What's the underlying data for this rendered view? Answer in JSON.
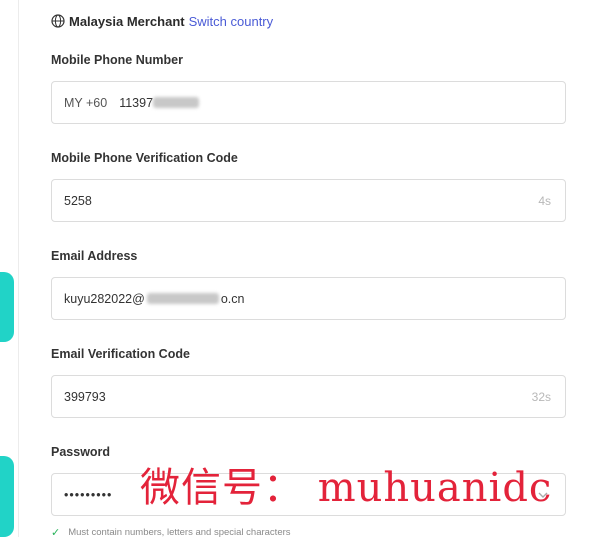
{
  "header": {
    "country_label": "Malaysia Merchant",
    "switch_label": "Switch country"
  },
  "fields": {
    "phone": {
      "label": "Mobile Phone Number",
      "prefix": "MY +60",
      "value": "11397"
    },
    "phone_code": {
      "label": "Mobile Phone Verification Code",
      "value": "5258",
      "timer": "4s"
    },
    "email": {
      "label": "Email Address",
      "value_start": "kuyu282022@",
      "value_end": "o.cn"
    },
    "email_code": {
      "label": "Email Verification Code",
      "value": "399793",
      "timer": "32s"
    },
    "password": {
      "label": "Password",
      "value": "•••••••••"
    }
  },
  "password_hint": "Must contain numbers, letters and special characters",
  "watermark": "微信号： muhuanidc",
  "colors": {
    "accent": "#4a5bd6",
    "teal": "#21d3c7",
    "watermark": "#e3233a",
    "check": "#27b35a"
  }
}
